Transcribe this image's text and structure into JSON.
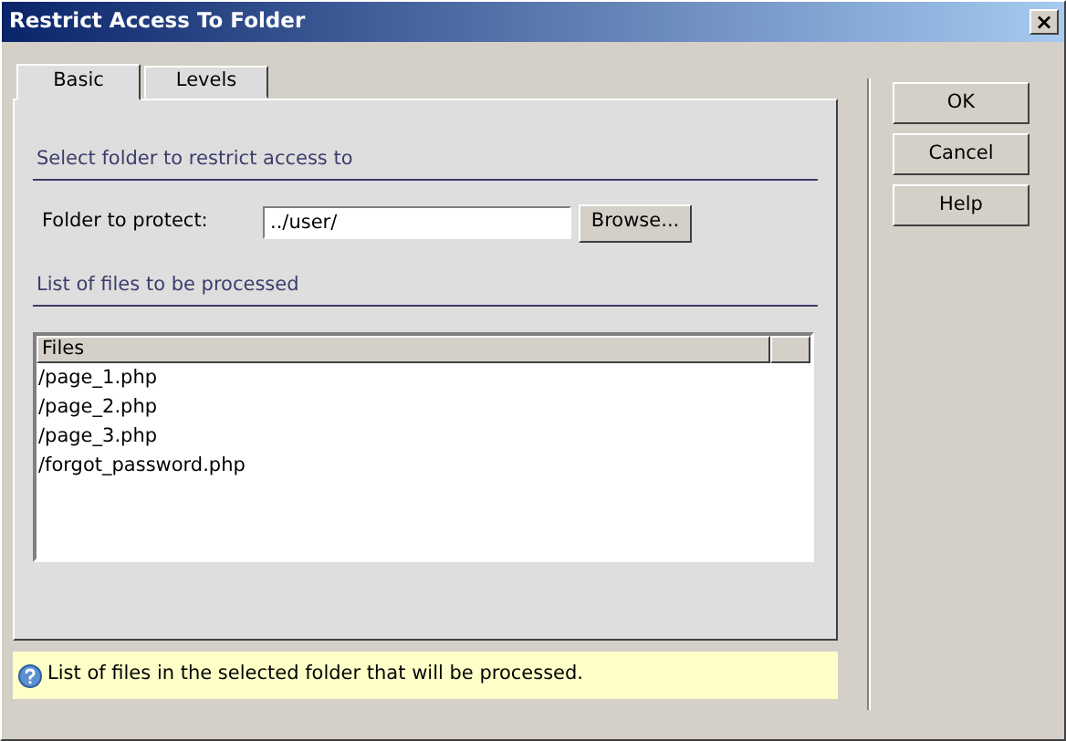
{
  "window": {
    "title": "Restrict Access To Folder",
    "close": "×"
  },
  "tabs": [
    {
      "label": "Basic",
      "selected": true
    },
    {
      "label": "Levels",
      "selected": false
    }
  ],
  "folder_section": {
    "heading": "Select folder to restrict access to",
    "label": "Folder to protect:",
    "value": "../user/",
    "browse": "Browse..."
  },
  "files_section": {
    "heading": "List of files to be processed",
    "column": "Files",
    "rows": [
      "/page_1.php",
      "/page_2.php",
      "/page_3.php",
      "/forgot_password.php"
    ]
  },
  "hint": "List of files in the selected folder that will be processed.",
  "buttons": [
    "OK",
    "Cancel",
    "Help"
  ]
}
